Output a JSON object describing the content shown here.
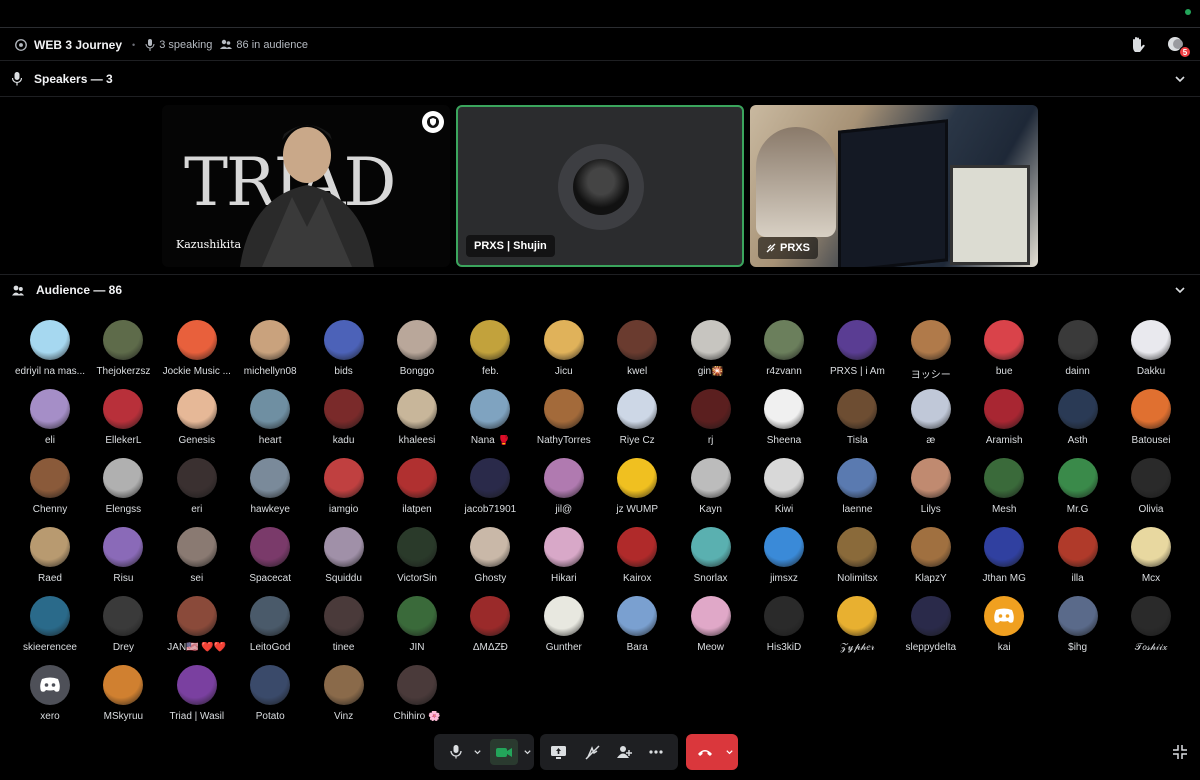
{
  "stage": {
    "title": "WEB 3 Journey",
    "speaking": "3 speaking",
    "audience_count": "86 in audience",
    "notification_badge": "5"
  },
  "speakers": {
    "heading": "Speakers — 3",
    "tiles": [
      {
        "name": "Kazushikita",
        "bg_text": "TRIAD"
      },
      {
        "name": "PRXS | Shujin"
      },
      {
        "name": "PRXS"
      }
    ]
  },
  "audience": {
    "heading": "Audience — 86",
    "members": [
      {
        "name": "edriyil na mas...",
        "color": "#a6d8f0"
      },
      {
        "name": "Thejokerzsz",
        "color": "#5e6b4a"
      },
      {
        "name": "Jockie Music ...",
        "color": "#e8603c"
      },
      {
        "name": "michellyn08",
        "color": "#c9a27d"
      },
      {
        "name": "bids",
        "color": "#4c62b8"
      },
      {
        "name": "Bonggo",
        "color": "#b9a79a"
      },
      {
        "name": "feb.",
        "color": "#c2a23c"
      },
      {
        "name": "Jicu",
        "color": "#e0b25a"
      },
      {
        "name": "kwel",
        "color": "#6a3b2f"
      },
      {
        "name": "gin🎇",
        "color": "#c7c5c0"
      },
      {
        "name": "r4zvann",
        "color": "#6b7f5c"
      },
      {
        "name": "PRXS | i Am",
        "color": "#5a3d93"
      },
      {
        "name": "ヨッシー",
        "color": "#b07a4a"
      },
      {
        "name": "bue",
        "color": "#d9434a"
      },
      {
        "name": "dainn",
        "color": "#3a3a3a"
      },
      {
        "name": "Dakku",
        "color": "#e9e9ee"
      },
      {
        "name": "eli",
        "color": "#a58ec7"
      },
      {
        "name": "EllekerL",
        "color": "#b8303a"
      },
      {
        "name": "Genesis",
        "color": "#e6b897"
      },
      {
        "name": "heart",
        "color": "#6f8fa2"
      },
      {
        "name": "kadu",
        "color": "#7a2a2a"
      },
      {
        "name": "khaleesi",
        "color": "#c8b69a"
      },
      {
        "name": "Nana 🥊",
        "color": "#7fa3c0"
      },
      {
        "name": "NathyTorres",
        "color": "#a36a3a"
      },
      {
        "name": "Riye Cz",
        "color": "#cdd7e6"
      },
      {
        "name": "rj",
        "color": "#5b1f1f"
      },
      {
        "name": "Sheena",
        "color": "#f0f0f0"
      },
      {
        "name": "Tisla",
        "color": "#6d4d32"
      },
      {
        "name": "æ",
        "color": "#c0c8d8"
      },
      {
        "name": "Aramish",
        "color": "#a82632"
      },
      {
        "name": "Asth",
        "color": "#2a3a55"
      },
      {
        "name": "Batousei",
        "color": "#e07030"
      },
      {
        "name": "Chenny",
        "color": "#8a5a3a"
      },
      {
        "name": "Elengss",
        "color": "#b0b0b0"
      },
      {
        "name": "eri",
        "color": "#3a3030"
      },
      {
        "name": "hawkeye",
        "color": "#7a8a9a"
      },
      {
        "name": "iamgio",
        "color": "#c04040"
      },
      {
        "name": "ilatpen",
        "color": "#b03030"
      },
      {
        "name": "jacob71901",
        "color": "#2a2a4a"
      },
      {
        "name": "jil@",
        "color": "#b07ab0"
      },
      {
        "name": "jz WUMP",
        "color": "#f0c020"
      },
      {
        "name": "Kayn",
        "color": "#bcbcbc"
      },
      {
        "name": "Kiwi",
        "color": "#d8d8d8"
      },
      {
        "name": "laenne",
        "color": "#5a7ab0"
      },
      {
        "name": "Lilys",
        "color": "#c08a70"
      },
      {
        "name": "Mesh",
        "color": "#3a6a3a"
      },
      {
        "name": "Mr.G",
        "color": "#3a8a4a"
      },
      {
        "name": "Olivia",
        "color": "#2a2a2a"
      },
      {
        "name": "Raed",
        "color": "#b89a70"
      },
      {
        "name": "Risu",
        "color": "#8a6ab8"
      },
      {
        "name": "sei",
        "color": "#8a7a72"
      },
      {
        "name": "Spacecat",
        "color": "#7a3a6a"
      },
      {
        "name": "Squiddu",
        "color": "#a090a8"
      },
      {
        "name": "VictorSin",
        "color": "#2a3a2a"
      },
      {
        "name": "Ghosty",
        "color": "#c9b8a8"
      },
      {
        "name": "Hikari",
        "color": "#d8a8c8"
      },
      {
        "name": "Kairox",
        "color": "#b02a2a"
      },
      {
        "name": "Snorlax",
        "color": "#5ab0b0"
      },
      {
        "name": "jimsxz",
        "color": "#3a8ad8"
      },
      {
        "name": "Nolimitsx",
        "color": "#8a6a3a"
      },
      {
        "name": "KlapzY",
        "color": "#a07040"
      },
      {
        "name": "Jthan MG",
        "color": "#3040a0"
      },
      {
        "name": "illa",
        "color": "#b03a2a"
      },
      {
        "name": "Mcx",
        "color": "#e8d8a0"
      },
      {
        "name": "skieerencee",
        "color": "#2a6a8a"
      },
      {
        "name": "Drey",
        "color": "#3a3a3a"
      },
      {
        "name": "JAN🇺🇸 ❤️❤️",
        "color": "#8a4a3a"
      },
      {
        "name": "LeitoGod",
        "color": "#4a5a6a"
      },
      {
        "name": "tinee",
        "color": "#4a3a3a"
      },
      {
        "name": "JIN",
        "color": "#3a6a3a"
      },
      {
        "name": "ΔΜΔΖĐ",
        "color": "#9a2a2a"
      },
      {
        "name": "Gunther",
        "color": "#e8e8e0"
      },
      {
        "name": "Bara",
        "color": "#7aa0d0"
      },
      {
        "name": "Meow",
        "color": "#e0a8c8"
      },
      {
        "name": "His3kiD",
        "color": "#2a2a2a"
      },
      {
        "name": "𝒵𝓎𝓅𝒽𝑒𝓇",
        "color": "#e8b030"
      },
      {
        "name": "sleppydelta",
        "color": "#2a2a4a"
      },
      {
        "name": "kai",
        "color": "#f0a020"
      },
      {
        "name": "$ihg",
        "color": "#5a6a8a"
      },
      {
        "name": "𝒯𝑜𝓈𝒽𝒾𝒾𝓍",
        "color": "#2a2a2a"
      },
      {
        "name": "xero",
        "color": "#4e5058"
      },
      {
        "name": "MSkyruu",
        "color": "#d08030"
      },
      {
        "name": "Triad | Wasil",
        "color": "#7a40a0"
      },
      {
        "name": "Potato",
        "color": "#3a4a6a"
      },
      {
        "name": "Vinz",
        "color": "#8a6a4a"
      },
      {
        "name": "Chihiro 🌸",
        "color": "#4a3a3a"
      }
    ]
  },
  "controls": {
    "mic": "microphone-icon",
    "camera": "camera-icon",
    "share": "screen-share-icon",
    "activity": "activity-off-icon",
    "invite": "invite-icon",
    "more": "more-icon",
    "end": "end-call-icon"
  },
  "colors": {
    "accent_green": "#3ba55d",
    "danger": "#da373c",
    "discord_blurple": "#5865f2"
  }
}
